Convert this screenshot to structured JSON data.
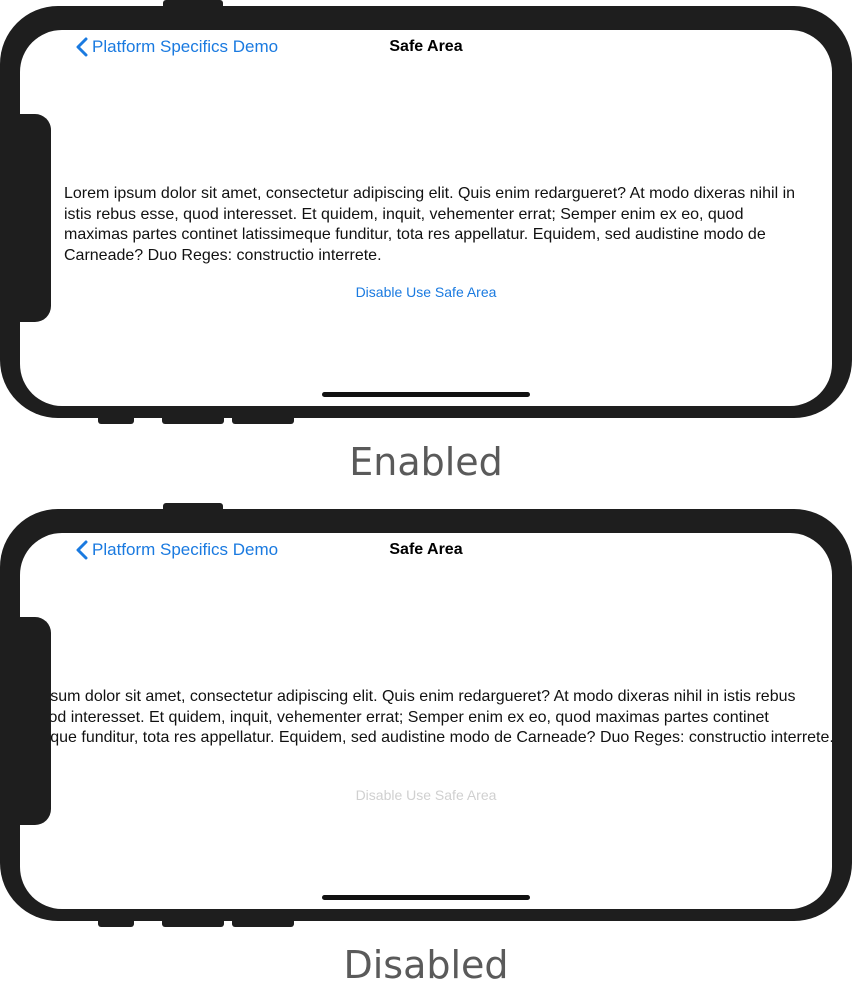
{
  "panels": [
    {
      "back_label": "Platform Specifics Demo",
      "title": "Safe Area",
      "body_text": "Lorem ipsum dolor sit amet, consectetur adipiscing elit. Quis enim redargueret? At modo dixeras nihil in istis rebus esse, quod interesset. Et quidem, inquit, vehementer errat; Semper enim ex eo, quod maximas partes continet latissimeque funditur, tota res appellatur. Equidem, sed audistine modo de Carneade? Duo Reges: constructio interrete.",
      "action_label": "Disable Use Safe Area",
      "caption": "Enabled"
    },
    {
      "back_label": "Platform Specifics Demo",
      "title": "Safe Area",
      "body_text": "Lorem ipsum dolor sit amet, consectetur adipiscing elit. Quis enim redargueret? At modo dixeras nihil in istis rebus esse, quod interesset. Et quidem, inquit, vehementer errat; Semper enim ex eo, quod maximas partes continet latissimeque funditur, tota res appellatur. Equidem, sed audistine modo de Carneade? Duo Reges: constructio interrete.",
      "action_label": "Disable Use Safe Area",
      "caption": "Disabled"
    }
  ],
  "colors": {
    "accent": "#1a7ae0",
    "device": "#1e1e1e",
    "disabled_text": "#d0d0d0",
    "caption": "#5a5a5a"
  },
  "icons": {
    "back": "chevron-left-icon"
  }
}
